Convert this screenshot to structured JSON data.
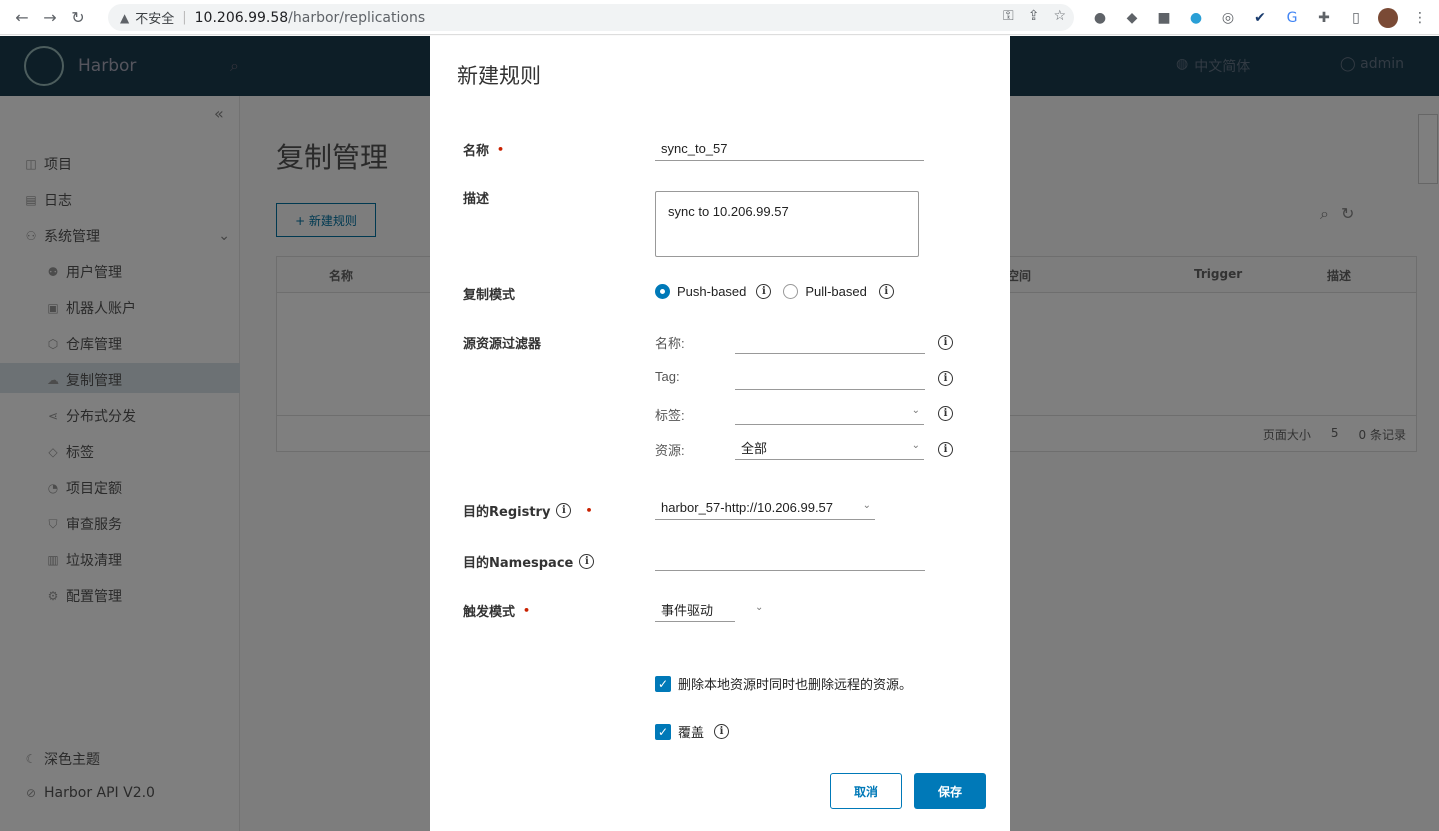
{
  "browser": {
    "security_label": "不安全",
    "url_host": "10.206.99.58",
    "url_path": "/harbor/replications"
  },
  "header": {
    "brand": "Harbor",
    "language": "中文简体",
    "user": "admin"
  },
  "sidebar": {
    "items": [
      {
        "label": "项目"
      },
      {
        "label": "日志"
      },
      {
        "label": "系统管理"
      },
      {
        "label": "用户管理"
      },
      {
        "label": "机器人账户"
      },
      {
        "label": "仓库管理"
      },
      {
        "label": "复制管理"
      },
      {
        "label": "分布式分发"
      },
      {
        "label": "标签"
      },
      {
        "label": "项目定额"
      },
      {
        "label": "审查服务"
      },
      {
        "label": "垃圾清理"
      },
      {
        "label": "配置管理"
      }
    ],
    "dark_theme": "深色主题",
    "api": "Harbor API V2.0"
  },
  "page": {
    "title": "复制管理",
    "new_rule": "+ 新建规则",
    "columns": [
      "名称",
      "空间",
      "Trigger",
      "描述"
    ],
    "page_size_label": "页面大小",
    "page_size": "5",
    "records": "0 条记录"
  },
  "modal": {
    "title": "新建规则",
    "name_label": "名称",
    "name_value": "sync_to_57",
    "desc_label": "描述",
    "desc_value": "sync to 10.206.99.57",
    "mode_label": "复制模式",
    "push_label": "Push-based",
    "pull_label": "Pull-based",
    "filter_label": "源资源过滤器",
    "filter_name_label": "名称:",
    "filter_tag_label": "Tag:",
    "filter_labels_label": "标签:",
    "filter_resource_label": "资源:",
    "filter_resource_value": "全部",
    "dest_registry_label": "目的Registry",
    "dest_registry_value": "harbor_57-http://10.206.99.57",
    "dest_ns_label": "目的Namespace",
    "trigger_label": "触发模式",
    "trigger_value": "事件驱动",
    "delete_remote_label": "删除本地资源时同时也删除远程的资源。",
    "override_label": "覆盖",
    "cancel": "取消",
    "save": "保存"
  },
  "colors": {
    "primary": "#0079b8",
    "header_bg": "#1b3c4e",
    "required": "#c92100"
  }
}
